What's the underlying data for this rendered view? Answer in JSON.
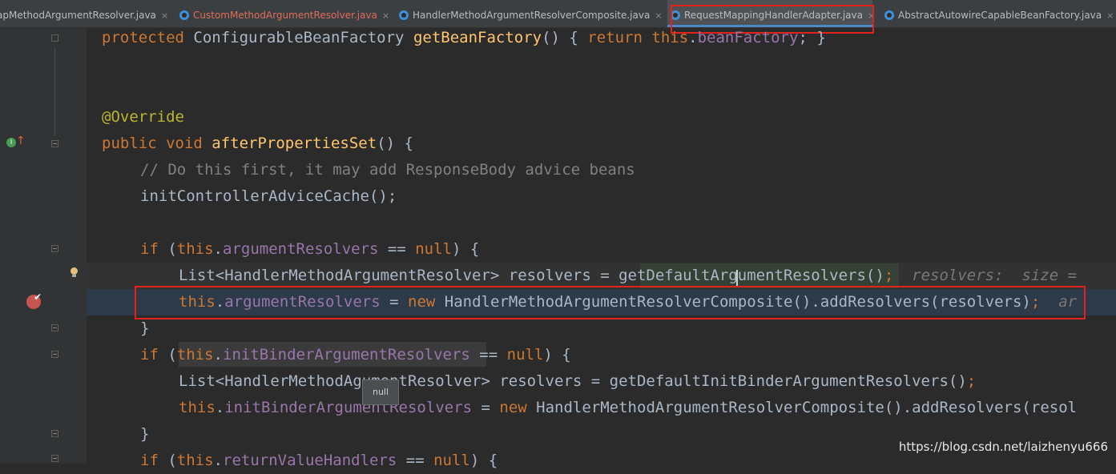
{
  "tabs": [
    {
      "label": "apMethodArgumentResolver.java",
      "state": "normal"
    },
    {
      "label": "CustomMethodArgumentResolver.java",
      "state": "modified"
    },
    {
      "label": "HandlerMethodArgumentResolverComposite.java",
      "state": "normal"
    },
    {
      "label": "RequestMappingHandlerAdapter.java",
      "state": "active"
    },
    {
      "label": "AbstractAutowireCapableBeanFactory.java",
      "state": "normal"
    }
  ],
  "tab_close_glyph": "×",
  "code": {
    "l1": {
      "kw": "protected ",
      "type": "ConfigurableBeanFactory ",
      "fn": "getBeanFactory",
      "rest": "() { ",
      "kw2": "return ",
      "this": "this",
      "dot": ".",
      "fld": "beanFactory",
      "end": "; }"
    },
    "l4": {
      "ann": "@Override"
    },
    "l5": {
      "kw": "public void ",
      "fn": "afterPropertiesSet",
      "rest": "() {"
    },
    "l6": {
      "cm": "// Do this first, it may add ResponseBody advice beans"
    },
    "l7": {
      "text": "initControllerAdviceCache();"
    },
    "l9": {
      "kw": "if ",
      "p1": "(",
      "this": "this",
      "dot": ".",
      "fld": "argumentResolvers",
      "mid": " == ",
      "null": "null",
      "end": ") {"
    },
    "l10": {
      "a": "List<HandlerMethodArgumentResolver> resolvers = ",
      "b": "getDefaultArgumentResolvers()",
      "semi": ";",
      "hint": "  resolvers:  size ="
    },
    "l11": {
      "this": "this",
      "dot": ".",
      "fld": "argumentResolvers",
      "a": " = ",
      "new": "new ",
      "b": "HandlerMethodArgumentResolverComposite().addResolvers(resolvers)",
      "semi": ";",
      "hint": "  ar"
    },
    "l12": {
      "text": "}"
    },
    "l13": {
      "kw": "if ",
      "p1": "(",
      "this": "this",
      "dot": ".",
      "fld": "initBinderArgumentResolvers",
      "mid": " == ",
      "null": "null",
      "end": ") {"
    },
    "l14": {
      "a": "List<HandlerMethodA",
      "b": "gumentResolver> resolvers = getDefaultInitBinderArgumentResolvers()",
      "semi": ";"
    },
    "l15": {
      "this": "this",
      "dot": ".",
      "fld": "initBinderArgumentResolvers",
      "a": " = ",
      "new": "new ",
      "b": "HandlerMethodArgumentResolverComposite().addResolvers(resol"
    },
    "l16": {
      "text": "}"
    },
    "l17": {
      "kw": "if ",
      "p1": "(",
      "this": "this",
      "dot": ".",
      "fld": "returnValueHandlers",
      "mid": " == ",
      "null": "null",
      "end": ") {"
    }
  },
  "tooltip": {
    "text": "null"
  },
  "watermark": "https://blog.csdn.net/laizhenyu666",
  "colors": {
    "keyword": "#cc7832",
    "field": "#9876aa",
    "method": "#ffc66d",
    "annotation": "#bbb529",
    "comment": "#808080",
    "highlight_box": "#e3221c"
  }
}
